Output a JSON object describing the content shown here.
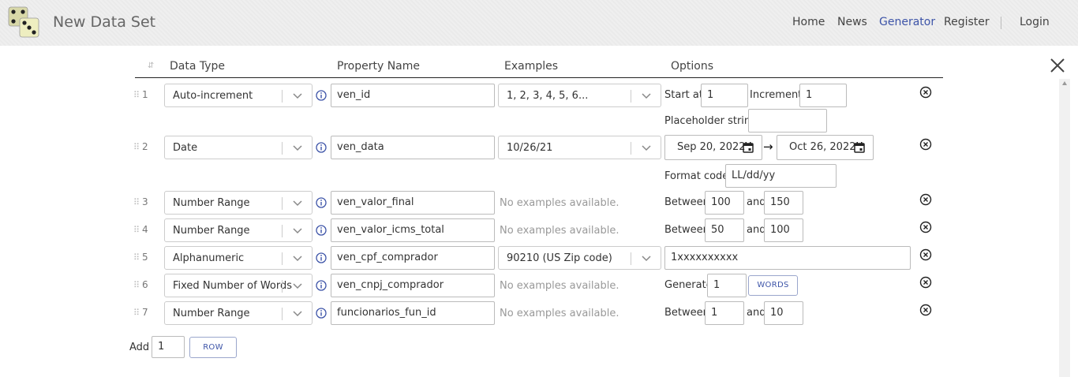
{
  "app": {
    "title": "New Data Set"
  },
  "nav": {
    "home": "Home",
    "news": "News",
    "generator": "Generator",
    "register": "Register",
    "login": "Login"
  },
  "table": {
    "headers": {
      "sort": "⇵",
      "data_type": "Data Type",
      "property_name": "Property Name",
      "examples": "Examples",
      "options": "Options"
    }
  },
  "rows": [
    {
      "num": "1",
      "type": "Auto-increment",
      "prop": "ven_id",
      "example": "1, 2, 3, 4, 5, 6...",
      "opts": {
        "start_label": "Start at:",
        "start": "1",
        "inc_label": "Increment:",
        "inc": "1",
        "placeholder_label": "Placeholder string:",
        "placeholder": ""
      }
    },
    {
      "num": "2",
      "type": "Date",
      "prop": "ven_data",
      "example": "10/26/21",
      "opts": {
        "from": "Sep 20, 2022",
        "arrow": "→",
        "to": "Oct 26, 2022",
        "format_label": "Format code:",
        "format": "LL/dd/yy"
      }
    },
    {
      "num": "3",
      "type": "Number Range",
      "prop": "ven_valor_final",
      "example": "No examples available.",
      "opts": {
        "between": "Between",
        "min": "100",
        "and": "and",
        "max": "150"
      }
    },
    {
      "num": "4",
      "type": "Number Range",
      "prop": "ven_valor_icms_total",
      "example": "No examples available.",
      "opts": {
        "between": "Between",
        "min": "50",
        "and": "and",
        "max": "100"
      }
    },
    {
      "num": "5",
      "type": "Alphanumeric",
      "prop": "ven_cpf_comprador",
      "example": "90210 (US Zip code)",
      "opts": {
        "pattern": "1xxxxxxxxxx"
      }
    },
    {
      "num": "6",
      "type": "Fixed Number of Words",
      "prop": "ven_cnpj_comprador",
      "example": "No examples available.",
      "opts": {
        "generate": "Generate",
        "count": "1",
        "unit": "WORDS"
      }
    },
    {
      "num": "7",
      "type": "Number Range",
      "prop": "funcionarios_fun_id",
      "example": "No examples available.",
      "opts": {
        "between": "Between",
        "min": "1",
        "and": "and",
        "max": "10"
      }
    }
  ],
  "footer": {
    "add_label": "Add",
    "add_count": "1",
    "row_button": "ROW"
  },
  "colors": {
    "accent": "#3d54a8",
    "header_bg": "#efefef"
  },
  "icons": [
    "dice-logo-icon",
    "close-icon",
    "info-icon",
    "chevron-down-icon",
    "remove-row-icon",
    "calendar-icon",
    "drag-handle-icon"
  ]
}
